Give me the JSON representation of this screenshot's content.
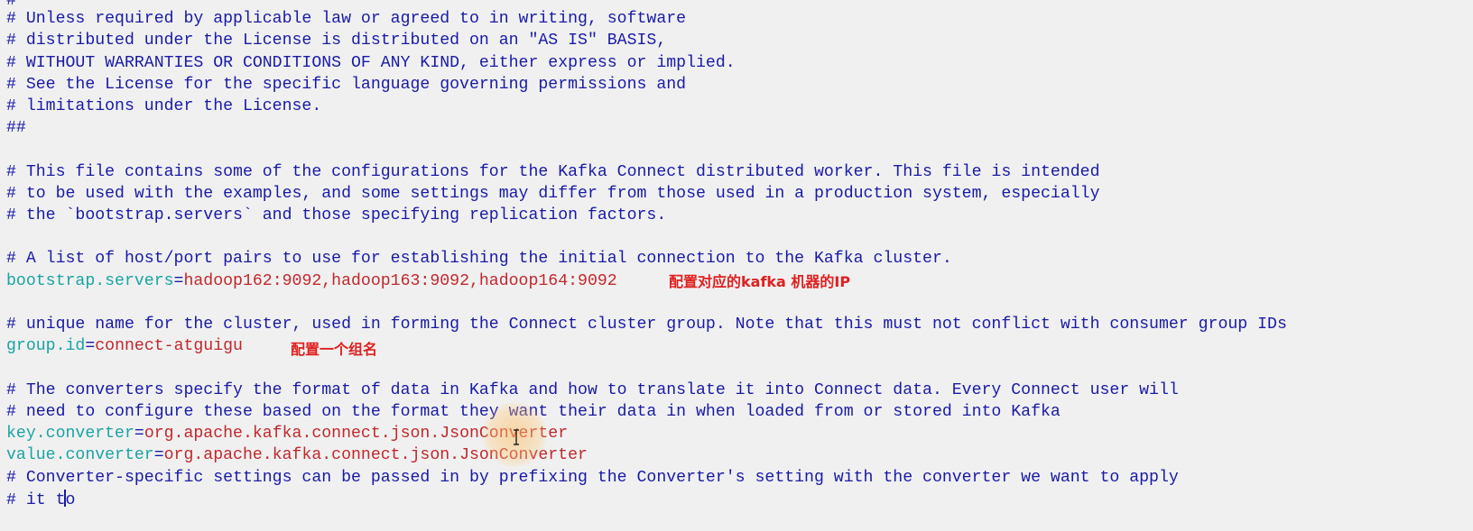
{
  "editor": {
    "lines": {
      "l0": "#",
      "l1": "# Unless required by applicable law or agreed to in writing, software",
      "l2": "# distributed under the License is distributed on an \"AS IS\" BASIS,",
      "l3": "# WITHOUT WARRANTIES OR CONDITIONS OF ANY KIND, either express or implied.",
      "l4": "# See the License for the specific language governing permissions and",
      "l5": "# limitations under the License.",
      "l6": "##",
      "l8": "# This file contains some of the configurations for the Kafka Connect distributed worker. This file is intended",
      "l9": "# to be used with the examples, and some settings may differ from those used in a production system, especially",
      "l10": "# the `bootstrap.servers` and those specifying replication factors.",
      "l12": "# A list of host/port pairs to use for establishing the initial connection to the Kafka cluster.",
      "l15": "# unique name for the cluster, used in forming the Connect cluster group. Note that this must not conflict with consumer group IDs",
      "l18": "# The converters specify the format of data in Kafka and how to translate it into Connect data. Every Connect user will",
      "l19": "# need to configure these based on the format they want their data in when loaded from or stored into Kafka",
      "l22": "# Converter-specific settings can be passed in by prefixing the Converter's setting with the converter we want to apply",
      "l23a": "# it t",
      "l23b": "o"
    },
    "settings": {
      "bootstrap_key": "bootstrap.servers",
      "bootstrap_value": "hadoop162:9092,hadoop163:9092,hadoop164:9092",
      "group_key": "group.id",
      "group_value": "connect-atguigu",
      "key_converter_key": "key.converter",
      "key_converter_value": "org.apache.kafka.connect.json.JsonConverter",
      "value_converter_key": "value.converter",
      "value_converter_value": "org.apache.kafka.connect.json.JsonConverter",
      "equals": "="
    },
    "annotations": {
      "bootstrap_note": "配置对应的kafka 机器的IP",
      "group_note": "配置一个组名"
    }
  },
  "colors": {
    "background": "#f0f0f0",
    "comment": "#1a1aa6",
    "key": "#1ba3a3",
    "value": "#c0282d",
    "annotation": "#e02020"
  }
}
